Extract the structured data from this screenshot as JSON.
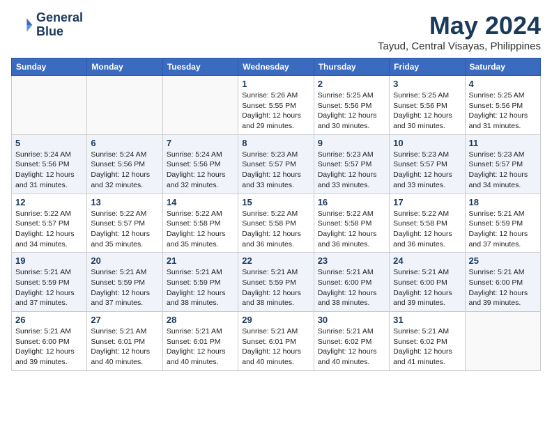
{
  "logo": {
    "line1": "General",
    "line2": "Blue"
  },
  "title": "May 2024",
  "location": "Tayud, Central Visayas, Philippines",
  "weekdays": [
    "Sunday",
    "Monday",
    "Tuesday",
    "Wednesday",
    "Thursday",
    "Friday",
    "Saturday"
  ],
  "weeks": [
    [
      {
        "day": "",
        "info": ""
      },
      {
        "day": "",
        "info": ""
      },
      {
        "day": "",
        "info": ""
      },
      {
        "day": "1",
        "info": "Sunrise: 5:26 AM\nSunset: 5:55 PM\nDaylight: 12 hours\nand 29 minutes."
      },
      {
        "day": "2",
        "info": "Sunrise: 5:25 AM\nSunset: 5:56 PM\nDaylight: 12 hours\nand 30 minutes."
      },
      {
        "day": "3",
        "info": "Sunrise: 5:25 AM\nSunset: 5:56 PM\nDaylight: 12 hours\nand 30 minutes."
      },
      {
        "day": "4",
        "info": "Sunrise: 5:25 AM\nSunset: 5:56 PM\nDaylight: 12 hours\nand 31 minutes."
      }
    ],
    [
      {
        "day": "5",
        "info": "Sunrise: 5:24 AM\nSunset: 5:56 PM\nDaylight: 12 hours\nand 31 minutes."
      },
      {
        "day": "6",
        "info": "Sunrise: 5:24 AM\nSunset: 5:56 PM\nDaylight: 12 hours\nand 32 minutes."
      },
      {
        "day": "7",
        "info": "Sunrise: 5:24 AM\nSunset: 5:56 PM\nDaylight: 12 hours\nand 32 minutes."
      },
      {
        "day": "8",
        "info": "Sunrise: 5:23 AM\nSunset: 5:57 PM\nDaylight: 12 hours\nand 33 minutes."
      },
      {
        "day": "9",
        "info": "Sunrise: 5:23 AM\nSunset: 5:57 PM\nDaylight: 12 hours\nand 33 minutes."
      },
      {
        "day": "10",
        "info": "Sunrise: 5:23 AM\nSunset: 5:57 PM\nDaylight: 12 hours\nand 33 minutes."
      },
      {
        "day": "11",
        "info": "Sunrise: 5:23 AM\nSunset: 5:57 PM\nDaylight: 12 hours\nand 34 minutes."
      }
    ],
    [
      {
        "day": "12",
        "info": "Sunrise: 5:22 AM\nSunset: 5:57 PM\nDaylight: 12 hours\nand 34 minutes."
      },
      {
        "day": "13",
        "info": "Sunrise: 5:22 AM\nSunset: 5:57 PM\nDaylight: 12 hours\nand 35 minutes."
      },
      {
        "day": "14",
        "info": "Sunrise: 5:22 AM\nSunset: 5:58 PM\nDaylight: 12 hours\nand 35 minutes."
      },
      {
        "day": "15",
        "info": "Sunrise: 5:22 AM\nSunset: 5:58 PM\nDaylight: 12 hours\nand 36 minutes."
      },
      {
        "day": "16",
        "info": "Sunrise: 5:22 AM\nSunset: 5:58 PM\nDaylight: 12 hours\nand 36 minutes."
      },
      {
        "day": "17",
        "info": "Sunrise: 5:22 AM\nSunset: 5:58 PM\nDaylight: 12 hours\nand 36 minutes."
      },
      {
        "day": "18",
        "info": "Sunrise: 5:21 AM\nSunset: 5:59 PM\nDaylight: 12 hours\nand 37 minutes."
      }
    ],
    [
      {
        "day": "19",
        "info": "Sunrise: 5:21 AM\nSunset: 5:59 PM\nDaylight: 12 hours\nand 37 minutes."
      },
      {
        "day": "20",
        "info": "Sunrise: 5:21 AM\nSunset: 5:59 PM\nDaylight: 12 hours\nand 37 minutes."
      },
      {
        "day": "21",
        "info": "Sunrise: 5:21 AM\nSunset: 5:59 PM\nDaylight: 12 hours\nand 38 minutes."
      },
      {
        "day": "22",
        "info": "Sunrise: 5:21 AM\nSunset: 5:59 PM\nDaylight: 12 hours\nand 38 minutes."
      },
      {
        "day": "23",
        "info": "Sunrise: 5:21 AM\nSunset: 6:00 PM\nDaylight: 12 hours\nand 38 minutes."
      },
      {
        "day": "24",
        "info": "Sunrise: 5:21 AM\nSunset: 6:00 PM\nDaylight: 12 hours\nand 39 minutes."
      },
      {
        "day": "25",
        "info": "Sunrise: 5:21 AM\nSunset: 6:00 PM\nDaylight: 12 hours\nand 39 minutes."
      }
    ],
    [
      {
        "day": "26",
        "info": "Sunrise: 5:21 AM\nSunset: 6:00 PM\nDaylight: 12 hours\nand 39 minutes."
      },
      {
        "day": "27",
        "info": "Sunrise: 5:21 AM\nSunset: 6:01 PM\nDaylight: 12 hours\nand 40 minutes."
      },
      {
        "day": "28",
        "info": "Sunrise: 5:21 AM\nSunset: 6:01 PM\nDaylight: 12 hours\nand 40 minutes."
      },
      {
        "day": "29",
        "info": "Sunrise: 5:21 AM\nSunset: 6:01 PM\nDaylight: 12 hours\nand 40 minutes."
      },
      {
        "day": "30",
        "info": "Sunrise: 5:21 AM\nSunset: 6:02 PM\nDaylight: 12 hours\nand 40 minutes."
      },
      {
        "day": "31",
        "info": "Sunrise: 5:21 AM\nSunset: 6:02 PM\nDaylight: 12 hours\nand 41 minutes."
      },
      {
        "day": "",
        "info": ""
      }
    ]
  ]
}
